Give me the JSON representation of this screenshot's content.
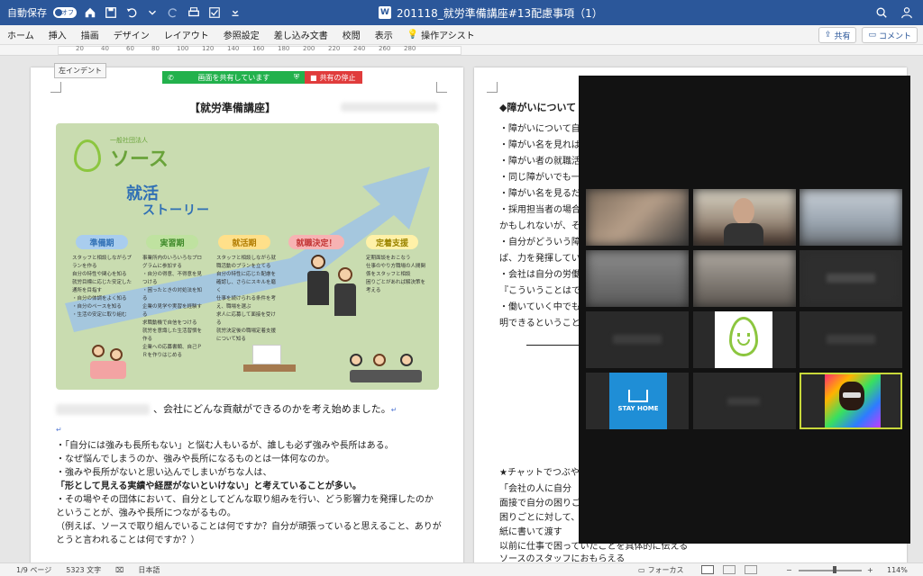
{
  "titlebar": {
    "autosave_label": "自動保存",
    "autosave_state": "オフ",
    "doc_title": "201118_就労準備講座#13配慮事項（1）",
    "doc_icon": "W"
  },
  "menu": {
    "items": [
      "ホーム",
      "挿入",
      "描画",
      "デザイン",
      "レイアウト",
      "参照設定",
      "差し込み文書",
      "校閲",
      "表示",
      "操作アシスト"
    ],
    "share_label": "共有",
    "comment_label": "コメント"
  },
  "ruler": {
    "numbers": [
      "20",
      "40",
      "60",
      "80",
      "100",
      "120",
      "140",
      "160",
      "180",
      "200",
      "220",
      "240",
      "260",
      "280"
    ]
  },
  "tooltip": {
    "indent": "左インデント"
  },
  "share_bar": {
    "sharing_label": "画面を共有しています",
    "stop_label": "共有の停止"
  },
  "page1": {
    "title": "【就労準備講座】",
    "poster": {
      "org": "一般社団法人",
      "brand": "ソース",
      "title1": "就活",
      "title2": "ストーリー",
      "stages": [
        {
          "label": "準備期",
          "color": "#a9cdee",
          "text": "#2f6fb5"
        },
        {
          "label": "実習期",
          "color": "#bfe2a0",
          "text": "#3f8a2a"
        },
        {
          "label": "就活期",
          "color": "#ffe08a",
          "text": "#b07b00"
        },
        {
          "label": "就職決定！",
          "color": "#f7b3b3",
          "text": "#c23535"
        },
        {
          "label": "定着支援",
          "color": "#fff1a8",
          "text": "#9a8400"
        }
      ],
      "columns": [
        [
          "スタッフと相談しながらプランを作る",
          "自分の特性や関心を知る",
          "就労目標に応じた安定した通所を目指す",
          "・自分の体調をよく知る",
          "・自分のペースを知る",
          "・生活の安定に取り組む"
        ],
        [
          "事業所内のいろいろなプログラムに参加する",
          "・自分の得意、不得意を見つける",
          "・困ったときの対処法を知る",
          "企業の見学や実習を経験する",
          "求職動機で自信をつける",
          "就労を意識した生活習慣を作る",
          "企業への応募書類、自己ＰＲを作りはじめる"
        ],
        [
          "スタッフと相談しながら就職活動のプランを立てる",
          "自分の特性に応じた配慮を確認し、さらにスキルを磨く",
          "仕事を続けられる条件を考え、職場を選ぶ",
          "求人に応募して面接を受ける",
          "就労決定後の職場定着支援について知る"
        ],
        [],
        [
          "定期面談をおこなう",
          "仕事のやり方職場の人間関係をスタッフと相談",
          "困りごとがあれば解決策を考える"
        ]
      ]
    },
    "para_blurred": "自分は何ができるのか",
    "para_main": "、会社にどんな貢献ができるのかを考え始めました。",
    "bullets": [
      "・「自分には強みも長所もない」と悩む人もいるが、誰しも必ず強みや長所はある。",
      "・なぜ悩んでしまうのか、強みや長所になるものとは一体何なのか。",
      "・強みや長所がないと思い込んでしまいがちな人は、",
      "「形として見える実績や経歴がないといけない」と考えていることが多い。",
      "・その場やその団体において、自分としてどんな取り組みを行い、どう影響力を発揮したのか",
      "ということが、強みや長所につながるもの。",
      "（例えば、ソースで取り組んでいることは何ですか？自分が頑張っていると思えること、ありが",
      "とうと言われることは何ですか？）"
    ]
  },
  "page2": {
    "heading": "◆障がいについて",
    "lines": [
      "・障がいについて自",
      "・障がい名を見れば",
      "・障がい者の就職活",
      "・同じ障がいでも一",
      "・障がい名を見るだ",
      "・採用担当者の場合",
      "かもしれないが、そ",
      "・自分がどういう障",
      "ば、力を発揮してい",
      "・会社は自分の労働",
      "『こういうことはで",
      "・働いていく中でも",
      "明できるということ"
    ],
    "chat_heading": "★チャットでつぶや",
    "chat_lines": [
      "「会社の人に自分",
      "面接で自分の困りご",
      "困りごとに対して、",
      "紙に書いて渡す",
      "以前に仕事で困っていたことを具体的に伝える",
      "ソースのスタッフにおもらえる"
    ]
  },
  "video": {
    "stay_home": "STAY HOME"
  },
  "status": {
    "page": "1/9 ページ",
    "words": "5323 文字",
    "lang": "日本語",
    "focus": "フォーカス",
    "zoom": "114%"
  }
}
